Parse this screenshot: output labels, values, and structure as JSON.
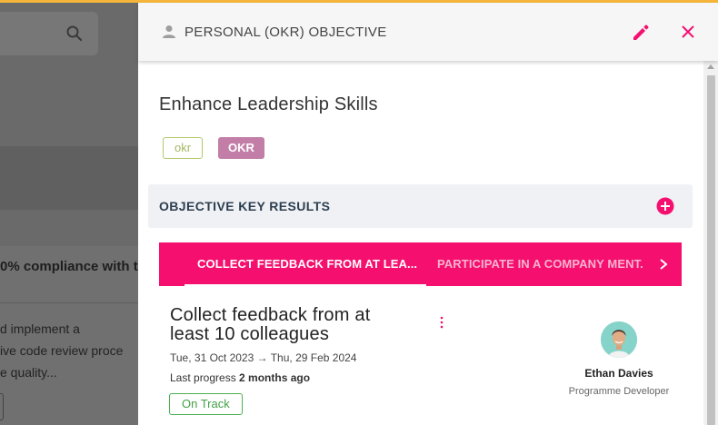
{
  "background": {
    "search_icon": "search-icon",
    "heading_fragment": "0% compliance with t",
    "description_lines": [
      "d implement a",
      "ive code review proce",
      "e quality..."
    ]
  },
  "panel": {
    "header": {
      "title": "PERSONAL (OKR) OBJECTIVE",
      "icons": {
        "type": "person-icon",
        "edit": "pencil-icon",
        "close": "close-icon"
      }
    },
    "objective_title": "Enhance Leadership Skills",
    "tags": [
      "okr",
      "OKR"
    ],
    "key_results_section": {
      "label": "OBJECTIVE KEY RESULTS",
      "add_icon": "plus-circle-icon"
    },
    "tabs": [
      {
        "label": "COLLECT FEEDBACK FROM AT LEA...",
        "active": true
      },
      {
        "label": "PARTICIPATE IN A COMPANY MENT.",
        "active": false
      }
    ],
    "key_result": {
      "title": "Collect feedback from at least 10 colleagues",
      "dates": "Tue, 31 Oct 2023 → Thu, 29 Feb 2024",
      "progress_label": "Last progress",
      "progress_value": "2 months ago",
      "status": "On Track",
      "owner": {
        "name": "Ethan Davies",
        "role": "Programme Developer"
      }
    }
  },
  "colors": {
    "accent_pink": "#f50f6f",
    "top_bar": "#f4b53a",
    "tag_okr_lower": "#a3b864",
    "tag_okr_upper_bg": "#c27ea7",
    "status_green": "#43a047"
  }
}
